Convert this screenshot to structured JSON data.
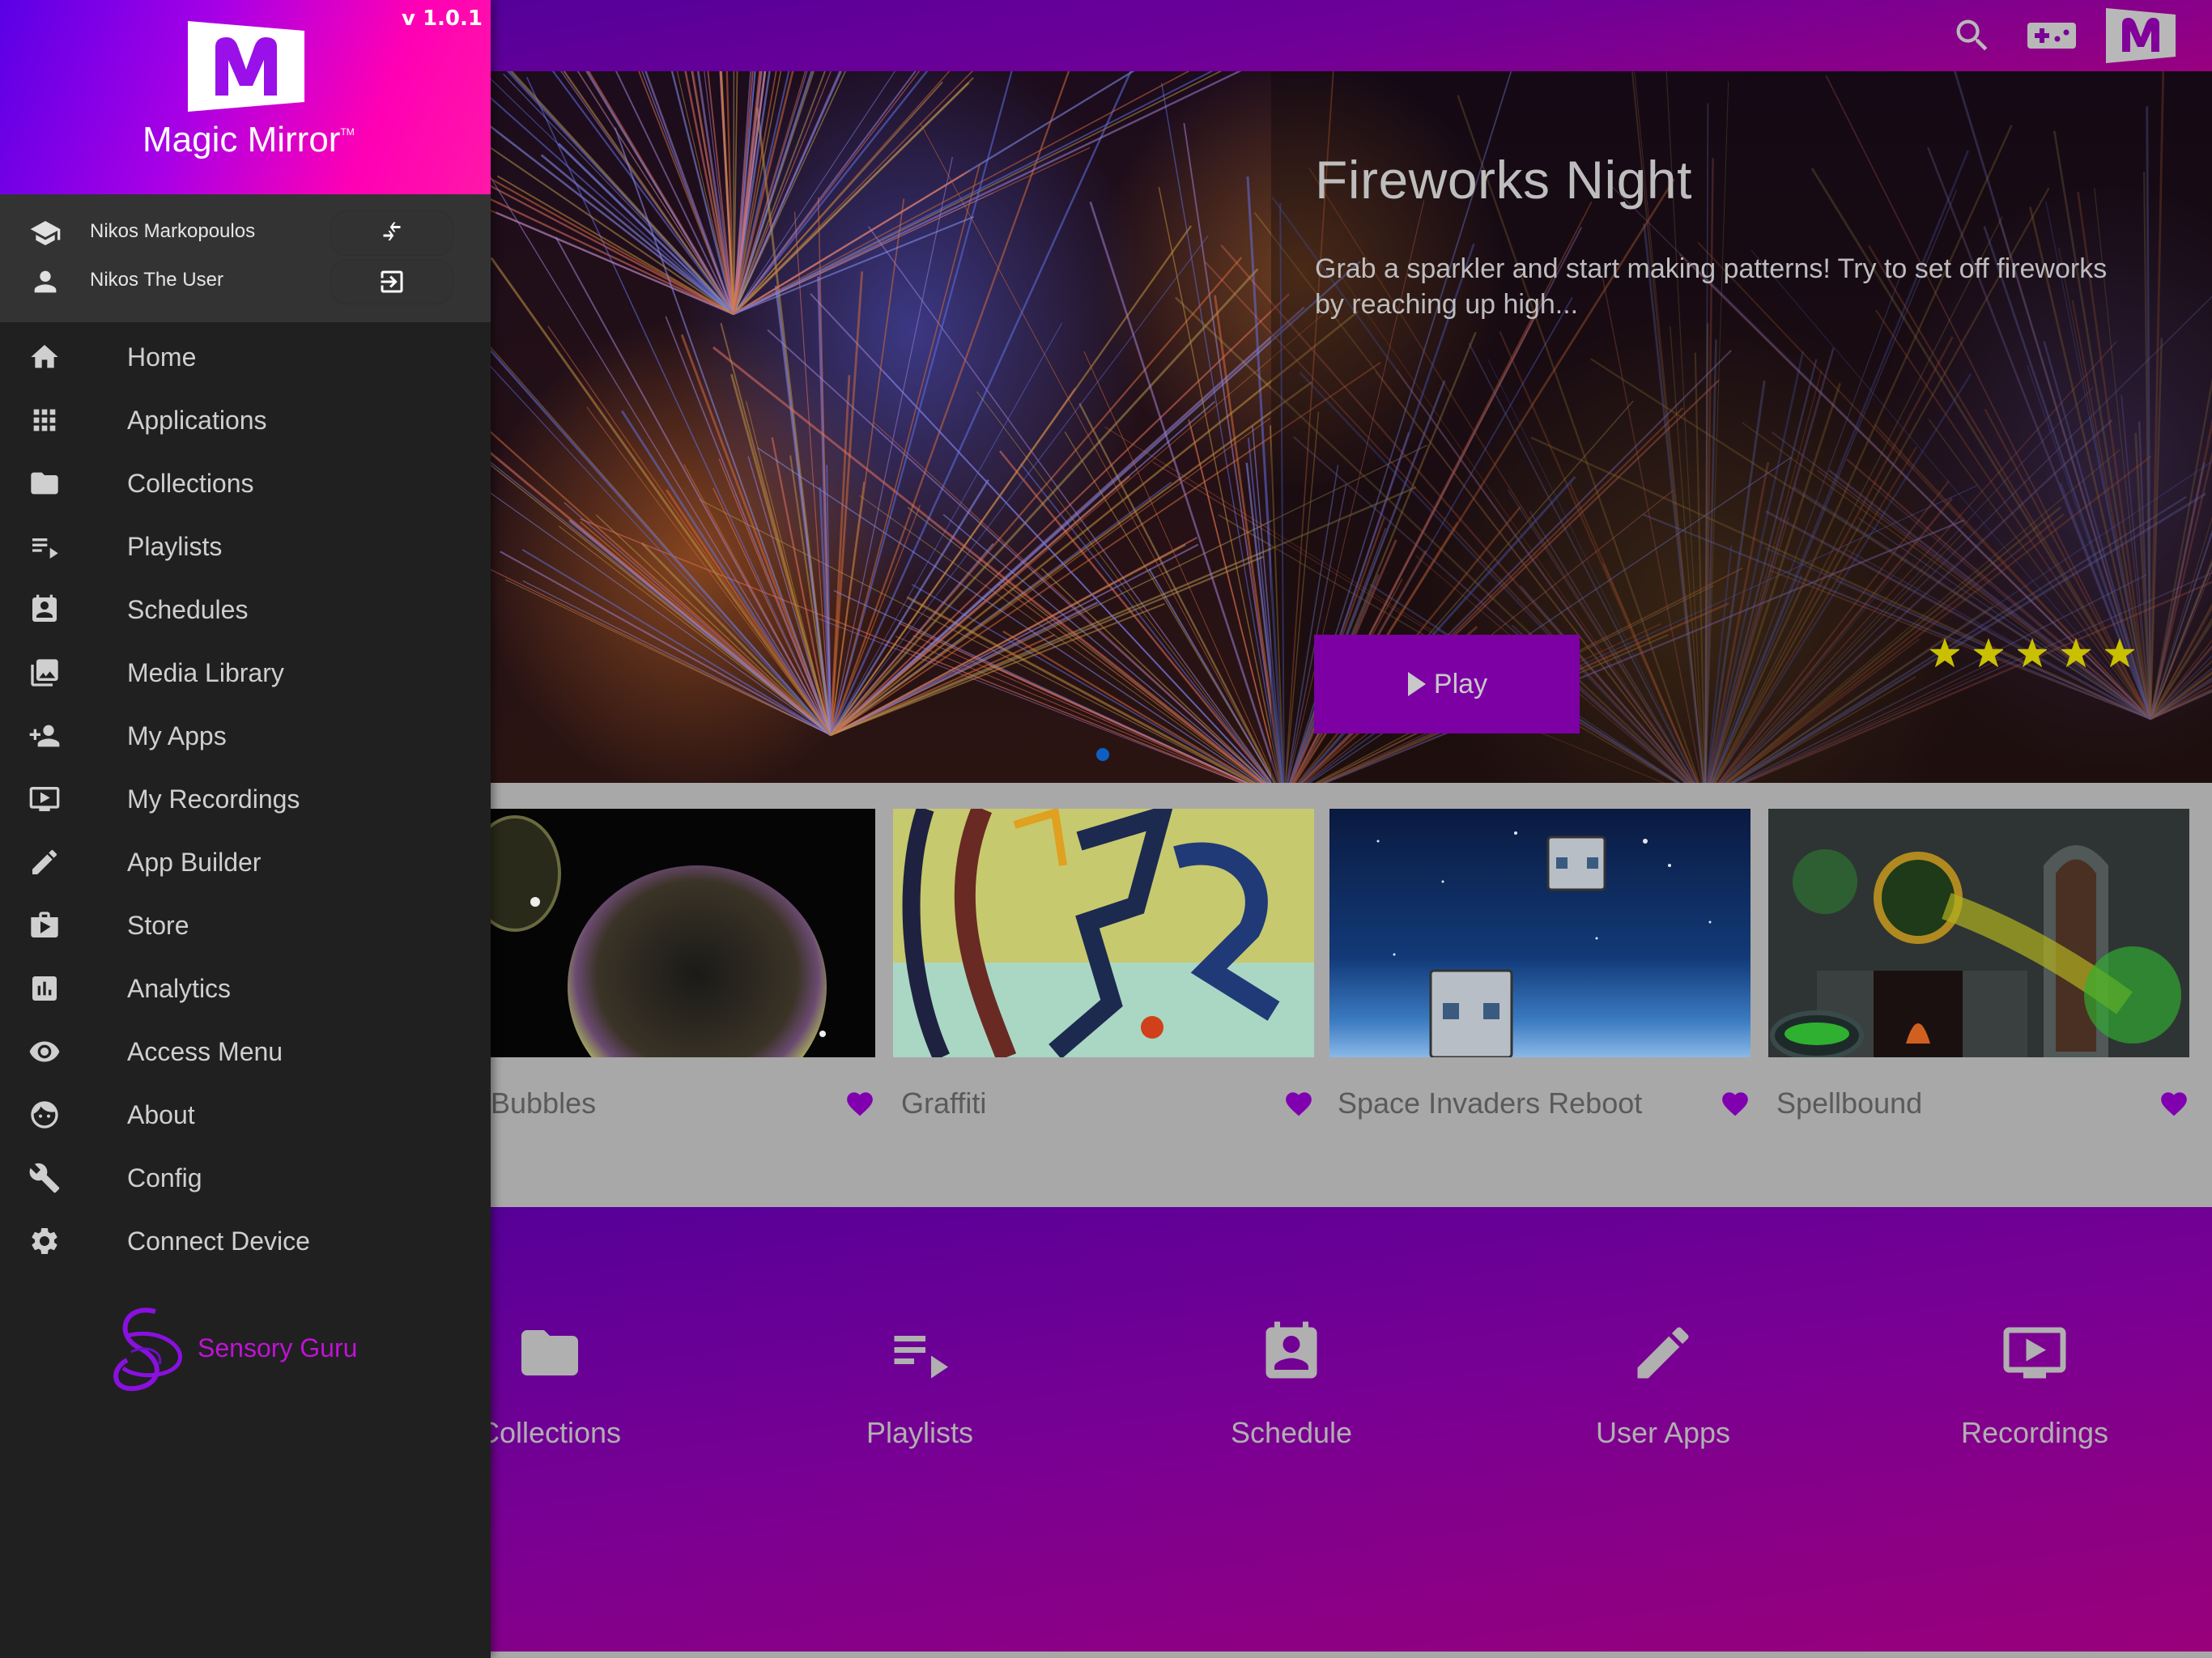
{
  "app": {
    "name": "Magic Mirror",
    "trademark": "TM",
    "version": "v 1.0.1"
  },
  "colors": {
    "accent": "#7c00a4",
    "heart": "#8000b0",
    "star": "#c8c000",
    "carousel_dot": "#0d5fc4",
    "brand_gradient_start": "#5a00e6",
    "brand_gradient_end": "#ff18a8",
    "sensory_guru": "#c012d6"
  },
  "users": [
    {
      "name": "Nikos Markopoulos",
      "icon": "school-icon",
      "action_icon": "swap-icon",
      "action": "switch-user"
    },
    {
      "name": "Nikos The User",
      "icon": "person-icon",
      "action_icon": "login-icon",
      "action": "login"
    }
  ],
  "sidebar": {
    "items": [
      {
        "label": "Home",
        "icon": "home-icon"
      },
      {
        "label": "Applications",
        "icon": "apps-grid-icon"
      },
      {
        "label": "Collections",
        "icon": "folder-icon"
      },
      {
        "label": "Playlists",
        "icon": "playlist-icon"
      },
      {
        "label": "Schedules",
        "icon": "contact-calendar-icon"
      },
      {
        "label": "Media Library",
        "icon": "photo-library-icon"
      },
      {
        "label": "My Apps",
        "icon": "person-add-icon"
      },
      {
        "label": "My Recordings",
        "icon": "ondemand-video-icon"
      },
      {
        "label": "App Builder",
        "icon": "pencil-icon"
      },
      {
        "label": "Store",
        "icon": "shop-icon"
      },
      {
        "label": "Analytics",
        "icon": "analytics-icon"
      },
      {
        "label": "Access Menu",
        "icon": "eye-icon"
      },
      {
        "label": "About",
        "icon": "face-icon"
      },
      {
        "label": "Config",
        "icon": "wrench-icon"
      },
      {
        "label": "Connect Device",
        "icon": "gear-icon"
      }
    ],
    "footer_brand": "Sensory Guru"
  },
  "topbar": {
    "icons": [
      "search-icon",
      "gamepad-icon",
      "magic-mirror-logo"
    ]
  },
  "hero": {
    "title": "Fireworks Night",
    "description": "Grab a sparkler and start making patterns! Try to set off fireworks by reaching up high...",
    "play_label": "Play",
    "rating": 5,
    "rating_max": 5,
    "carousel_active_index": 0
  },
  "cards": [
    {
      "title": "Bubbles",
      "favorite": true
    },
    {
      "title": "Graffiti",
      "favorite": true
    },
    {
      "title": "Space Invaders Reboot",
      "favorite": true
    },
    {
      "title": "Spellbound",
      "favorite": true
    }
  ],
  "quick_links": [
    {
      "label": "Collections",
      "icon": "folder-icon"
    },
    {
      "label": "Playlists",
      "icon": "playlist-icon"
    },
    {
      "label": "Schedule",
      "icon": "contact-calendar-icon"
    },
    {
      "label": "User Apps",
      "icon": "pencil-icon"
    },
    {
      "label": "Recordings",
      "icon": "ondemand-video-icon"
    }
  ]
}
